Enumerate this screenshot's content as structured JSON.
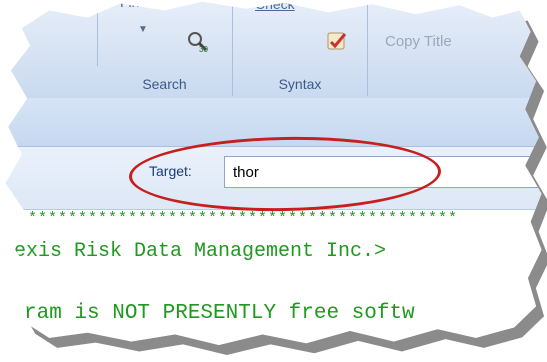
{
  "ribbon": {
    "groups": [
      {
        "label": "Search",
        "button_label": "Find"
      },
      {
        "label": "Syntax",
        "button_label": "Check"
      }
    ],
    "copy_title": "Copy Title"
  },
  "target": {
    "label": "Target:",
    "value": "thor"
  },
  "code": {
    "line1": "*******************************************",
    "line2": "exis Risk Data Management Inc.>",
    "line3": "ram is NOT PRESENTLY free softw"
  },
  "colors": {
    "annotation": "#c81e1e",
    "code_text": "#1f9a1f"
  }
}
